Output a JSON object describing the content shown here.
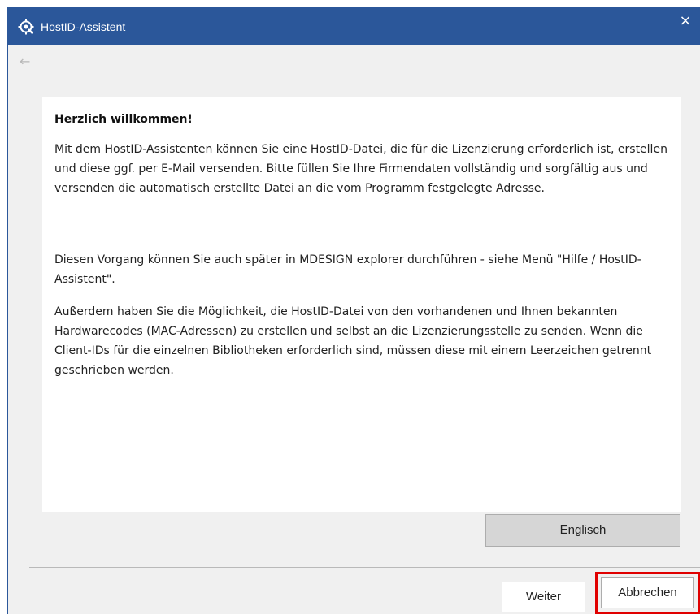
{
  "window": {
    "title": "HostID-Assistent",
    "close_glyph": "×",
    "back_glyph": "←",
    "title_bar_color": "#2b579a"
  },
  "content": {
    "heading": "Herzlich willkommen!",
    "paragraph1": "Mit dem HostID-Assistenten können Sie eine HostID-Datei, die für die Lizenzierung erforderlich ist, erstellen und diese ggf. per E-Mail versenden. Bitte füllen Sie Ihre Firmendaten vollständig und sorgfältig aus und versenden die automatisch erstellte Datei an die vom Programm festgelegte Adresse.",
    "paragraph2": "Diesen Vorgang können Sie auch später in MDESIGN explorer durchführen - siehe Menü \"Hilfe / HostID-Assistent\".",
    "paragraph3": "Außerdem haben Sie die Möglichkeit, die HostID-Datei von den vorhandenen und Ihnen bekannten Hardwarecodes (MAC-Adressen) zu erstellen und selbst an die Lizenzierungsstelle zu senden. Wenn die Client-IDs für die einzelnen Bibliotheken erforderlich sind, müssen diese mit einem Leerzeichen getrennt geschrieben werden."
  },
  "buttons": {
    "language": "Englisch",
    "next": "Weiter",
    "cancel": "Abbrechen"
  },
  "highlight_color": "#e00000"
}
